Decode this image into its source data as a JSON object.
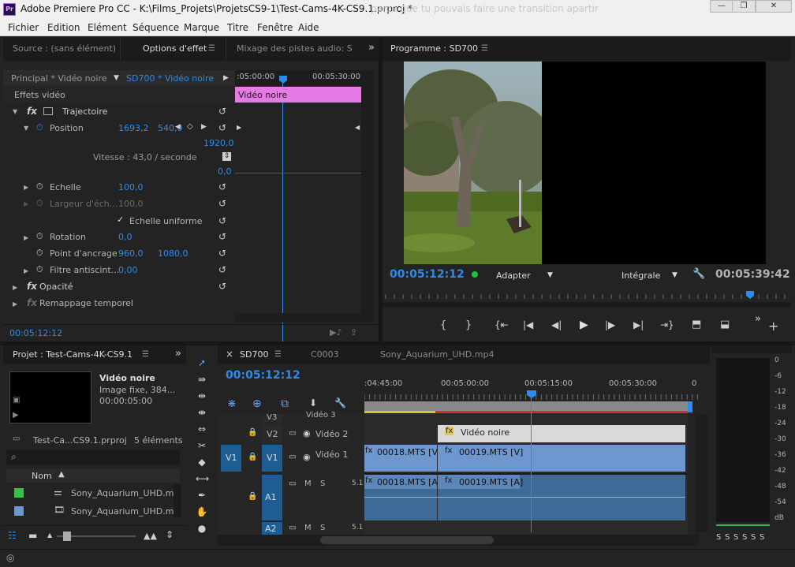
{
  "window": {
    "app_icon": "Pr",
    "title": "Adobe Premiere Pro CC - K:\\Films_Projets\\ProjetsCS9-1\\Test-Cams-4K-CS9.1.prproj *",
    "bg_text": "parce que tu pouvais faire une transition apartir"
  },
  "menu": [
    "Fichier",
    "Edition",
    "Elément",
    "Séquence",
    "Marque",
    "Titre",
    "Fenêtre",
    "Aide"
  ],
  "effect_panel": {
    "tabs": [
      "Source : (sans élément)",
      "Options d'effet",
      "Mixage des pistes audio: S"
    ],
    "more": "»",
    "clip_principal": "Principal * Vidéo noire",
    "clip_sequence": "SD700 * Vidéo noire",
    "tc_start": ":05:00:00",
    "tc_end": "00:05:30:00",
    "clip_bar_label": "Vidéo noire",
    "section": "Effets vidéo",
    "fx": "fx",
    "trajectoire": "Trajectoire",
    "position_label": "Position",
    "position_x": "1693,2",
    "position_y": "540,0",
    "graph_top": "1920,0",
    "speed": "Vitesse : 43,0 / seconde",
    "graph_bottom": "0,0",
    "echelle_label": "Echelle",
    "echelle": "100,0",
    "largeur_label": "Largeur d'éch...",
    "largeur": "100,0",
    "uniforme": "Echelle uniforme",
    "rotation_label": "Rotation",
    "rotation": "0,0",
    "ancrage_label": "Point d'ancrage",
    "ancrage_x": "960,0",
    "ancrage_y": "1080,0",
    "filtre_label": "Filtre antiscint...",
    "filtre": "0,00",
    "opacite": "Opacité",
    "remappage": "Remappage temporel",
    "timecode": "00:05:12:12"
  },
  "program": {
    "title": "Programme : SD700",
    "timecode": "00:05:12:12",
    "fit": "Adapter",
    "quality": "Intégrale",
    "duration": "00:05:39:42",
    "status_color": "#22c33a"
  },
  "project": {
    "title": "Projet : Test-Cams-4K-CS9.1",
    "more": "»",
    "clip_name": "Vidéo noire",
    "clip_type": "Image fixe, 384...",
    "clip_dur": "00:00:05:00",
    "proj_file": "Test-Ca...CS9.1.prproj",
    "count": "5 éléments",
    "col_name": "Nom",
    "items": [
      {
        "name": "Sony_Aquarium_UHD.mp",
        "color": "#36c04c"
      },
      {
        "name": "Sony_Aquarium_UHD.mi",
        "color": "#6e96cf"
      }
    ]
  },
  "timeline": {
    "tabs": [
      "SD700",
      "C0003",
      "Sony_Aquarium_UHD.mp4"
    ],
    "close": "×",
    "timecode": "00:05:12:12",
    "ruler": [
      ":04:45:00",
      "00:05:00:00",
      "00:05:15:00",
      "00:05:30:00",
      "0"
    ],
    "tracks": {
      "v3": "V3",
      "v3_name": "Vidéo 3",
      "v2": "V2",
      "v2_name": "Vidéo 2",
      "v1_src": "V1",
      "v1": "V1",
      "v1_name": "Vidéo 1",
      "a1": "A1",
      "a2": "A2",
      "m": "M",
      "s": "S",
      "ch": "5.1"
    },
    "clips": {
      "noire": "Vidéo noire",
      "v18": "00018.MTS [V]",
      "v19": "00019.MTS [V]",
      "a18": "00018.MTS [A]",
      "a19": "00019.MTS [A]"
    }
  },
  "meter": {
    "db": [
      "0",
      "-6",
      "-12",
      "-18",
      "-24",
      "-30",
      "-36",
      "-42",
      "-48",
      "-54",
      "dB"
    ],
    "solo": [
      "S",
      "S",
      "S",
      "S",
      "S",
      "S"
    ]
  }
}
